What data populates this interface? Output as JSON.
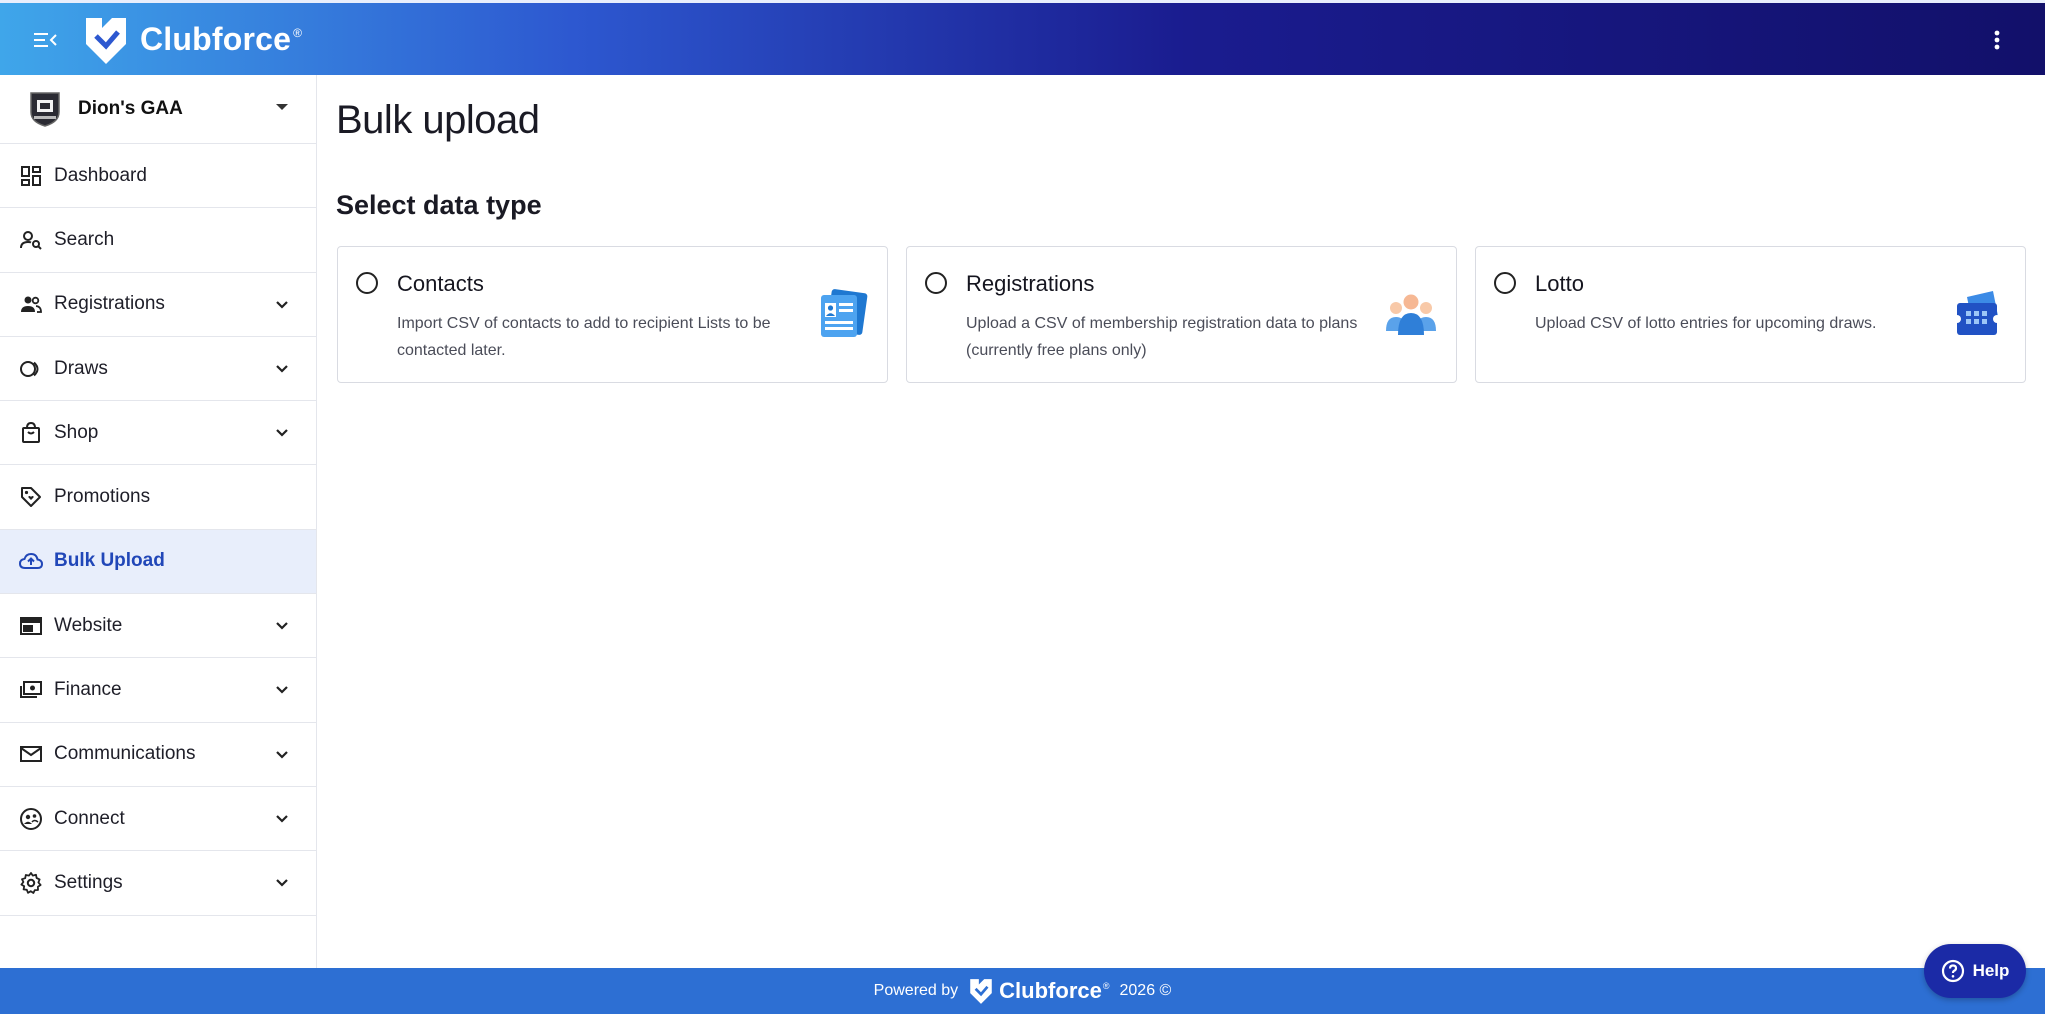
{
  "topbar": {
    "brand": "Clubforce",
    "brand_mark": "®",
    "menu_icon": "menu-collapse-icon",
    "more_icon": "more-vertical-icon"
  },
  "sidebar": {
    "club_name": "Dion's GAA",
    "items": [
      {
        "label": "Dashboard",
        "icon": "dashboard-icon",
        "expandable": false
      },
      {
        "label": "Search",
        "icon": "person-search-icon",
        "expandable": false
      },
      {
        "label": "Registrations",
        "icon": "group-icon",
        "expandable": true
      },
      {
        "label": "Draws",
        "icon": "draws-icon",
        "expandable": true
      },
      {
        "label": "Shop",
        "icon": "shopping-bag-icon",
        "expandable": true
      },
      {
        "label": "Promotions",
        "icon": "tag-icon",
        "expandable": false
      },
      {
        "label": "Bulk Upload",
        "icon": "cloud-upload-icon",
        "expandable": false,
        "active": true
      },
      {
        "label": "Website",
        "icon": "web-icon",
        "expandable": true
      },
      {
        "label": "Finance",
        "icon": "payments-icon",
        "expandable": true
      },
      {
        "label": "Communications",
        "icon": "mail-icon",
        "expandable": true
      },
      {
        "label": "Connect",
        "icon": "connect-icon",
        "expandable": true
      },
      {
        "label": "Settings",
        "icon": "gear-icon",
        "expandable": true
      }
    ]
  },
  "main": {
    "title": "Bulk upload",
    "section_title": "Select data type",
    "cards": [
      {
        "title": "Contacts",
        "description": "Import CSV of contacts to add to recipient Lists to be contacted later.",
        "icon": "contacts-document-icon"
      },
      {
        "title": "Registrations",
        "description": "Upload a CSV of membership registration data to plans (currently free plans only)",
        "icon": "members-group-icon"
      },
      {
        "title": "Lotto",
        "description": "Upload CSV of lotto entries for upcoming draws.",
        "icon": "lotto-ticket-icon"
      }
    ]
  },
  "footer": {
    "powered_by": "Powered by",
    "brand": "Clubforce",
    "brand_mark": "®",
    "year": "2026 ©"
  },
  "help": {
    "label": "Help",
    "icon": "help-circle-icon"
  },
  "colors": {
    "accent": "#2147b8",
    "active_bg": "#e8eefb",
    "footer": "#2d6fd3",
    "help_button": "#1b2aa6"
  }
}
